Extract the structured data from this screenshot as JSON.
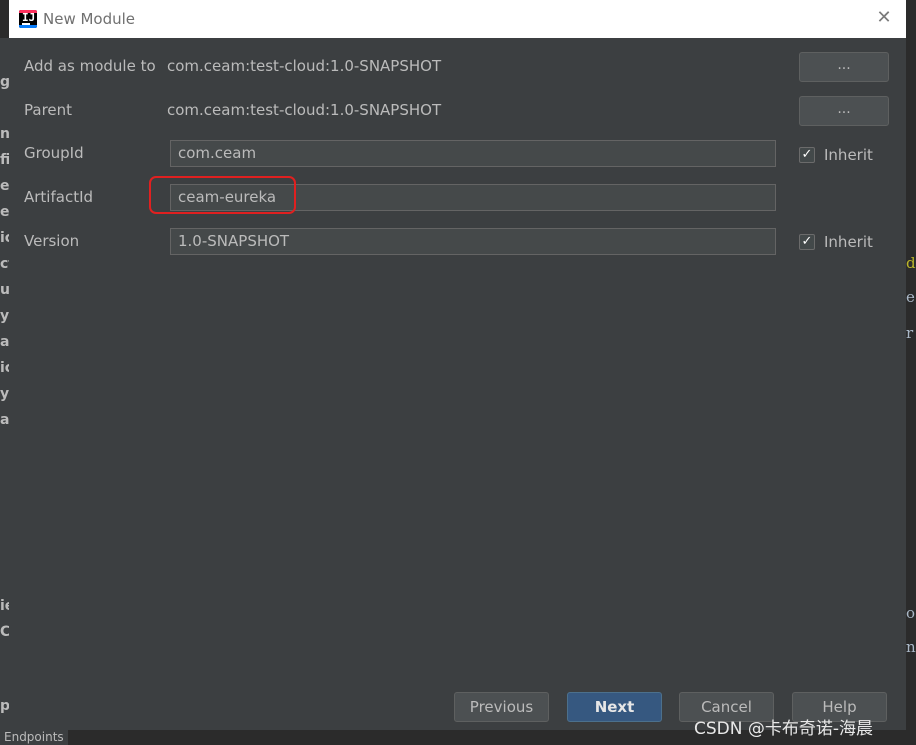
{
  "window": {
    "title": "New Module"
  },
  "form": {
    "add_as_module_to": {
      "label": "Add as module to",
      "value": "com.ceam:test-cloud:1.0-SNAPSHOT",
      "button": "..."
    },
    "parent": {
      "label": "Parent",
      "value": "com.ceam:test-cloud:1.0-SNAPSHOT",
      "button": "..."
    },
    "group_id": {
      "label": "GroupId",
      "value": "com.ceam",
      "inherit_label": "Inherit",
      "inherit_checked": true
    },
    "artifact_id": {
      "label": "ArtifactId",
      "value": "ceam-eureka"
    },
    "version": {
      "label": "Version",
      "value": "1.0-SNAPSHOT",
      "inherit_label": "Inherit",
      "inherit_checked": true
    }
  },
  "buttons": {
    "previous": "Previous",
    "next": "Next",
    "cancel": "Cancel",
    "help": "Help"
  },
  "background": {
    "left_fragments": [
      "g",
      "n",
      "fig",
      "ek",
      "ev",
      "ic",
      "ct",
      "u",
      "ys",
      "al",
      "ic",
      "ys",
      "al",
      "ie",
      "C",
      "p"
    ],
    "right_fragments": [
      "d",
      "e",
      "r",
      "o",
      "n"
    ],
    "bottom_tab": "Endpoints"
  },
  "watermark": "CSDN @卡布奇诺-海晨",
  "colors": {
    "accent": "#365880",
    "highlight": "#e02020",
    "dialog_bg": "#3c3f41"
  }
}
